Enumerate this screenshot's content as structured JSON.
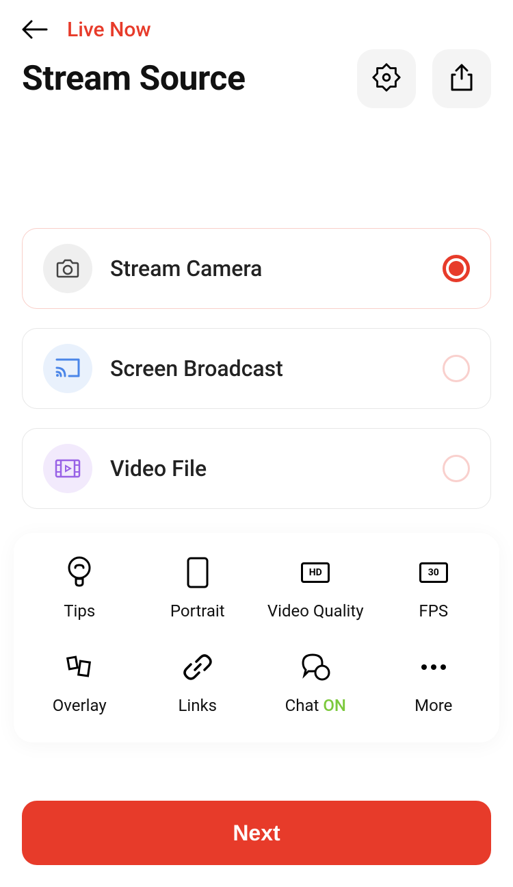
{
  "header": {
    "live_now": "Live Now",
    "title": "Stream Source"
  },
  "options": [
    {
      "label": "Stream Camera",
      "selected": true
    },
    {
      "label": "Screen Broadcast",
      "selected": false
    },
    {
      "label": "Video File",
      "selected": false
    }
  ],
  "grid": {
    "tips": "Tips",
    "portrait": "Portrait",
    "video_quality": "Video Quality",
    "video_quality_badge": "HD",
    "fps": "FPS",
    "fps_badge": "30",
    "overlay": "Overlay",
    "links": "Links",
    "chat": "Chat",
    "chat_status": "ON",
    "more": "More"
  },
  "next_button": "Next"
}
